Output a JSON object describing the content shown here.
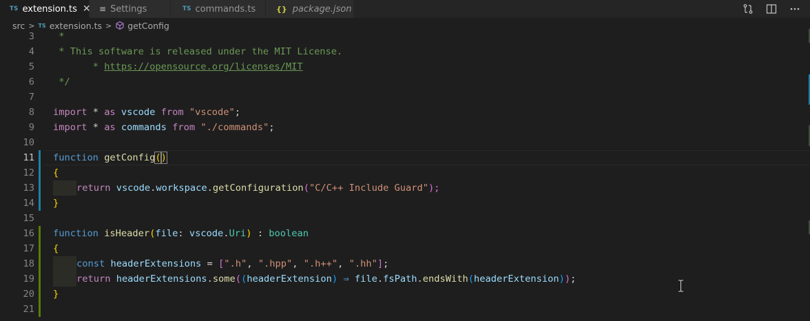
{
  "tabs": [
    {
      "badge": "TS",
      "label": "extension.ts",
      "active": true,
      "close": "✕"
    },
    {
      "badge": "≡",
      "label": "Settings"
    },
    {
      "badge": "TS",
      "label": "commands.ts"
    },
    {
      "badge": "{}",
      "label": "package.json"
    }
  ],
  "breadcrumb": {
    "folder": "src",
    "file_badge": "TS",
    "file": "extension.ts",
    "symbol": "getConfig",
    "separator": ">"
  },
  "editor": {
    "current_line": 11,
    "lines": [
      {
        "n": "3"
      },
      {
        "n": "4"
      },
      {
        "n": "5"
      },
      {
        "n": "6"
      },
      {
        "n": "7"
      },
      {
        "n": "8"
      },
      {
        "n": "9"
      },
      {
        "n": "10"
      },
      {
        "n": "11"
      },
      {
        "n": "12"
      },
      {
        "n": "13"
      },
      {
        "n": "14"
      },
      {
        "n": "15"
      },
      {
        "n": "16"
      },
      {
        "n": "17"
      },
      {
        "n": "18"
      },
      {
        "n": "19"
      },
      {
        "n": "20"
      },
      {
        "n": "21"
      }
    ],
    "code": {
      "l3": " *",
      "l4": " * This software is released under the MIT License.",
      "l5_prefix": " * ",
      "l5_link": "https://opensource.org/licenses/MIT",
      "l6": " */",
      "l8": [
        "import",
        " * ",
        "as",
        " ",
        "vscode",
        " ",
        "from",
        " ",
        "\"vscode\"",
        ";"
      ],
      "l9": [
        "import",
        " * ",
        "as",
        " ",
        "commands",
        " ",
        "from",
        " ",
        "\"./commands\"",
        ";"
      ],
      "l11": [
        "function",
        " ",
        "getConfig",
        "(",
        ")"
      ],
      "l12": "{",
      "l13": [
        "return",
        " ",
        "vscode",
        ".",
        "workspace",
        ".",
        "getConfiguration",
        "(",
        "\"C/C++ Include Guard\"",
        ");"
      ],
      "l14": "}",
      "l16": [
        "function",
        " ",
        "isHeader",
        "(",
        "file",
        ": ",
        "vscode",
        ".",
        "Uri",
        ")",
        " : ",
        "boolean"
      ],
      "l17": "{",
      "l18": [
        "const",
        " ",
        "headerExtensions",
        " = ",
        "[",
        "\".h\"",
        ", ",
        "\".hpp\"",
        ", ",
        "\".h++\"",
        ", ",
        "\".hh\"",
        "]",
        ";"
      ],
      "l19": [
        "return",
        " ",
        "headerExtensions",
        ".",
        "some",
        "(",
        "(",
        "headerExtension",
        ")",
        " ⇒ ",
        "file",
        ".",
        "fsPath",
        ".",
        "endsWith",
        "(",
        "headerExtension",
        ")",
        ")",
        ";"
      ],
      "l20": "}"
    }
  },
  "colors": {
    "background": "#1e1e1e",
    "comment": "#6a9955",
    "keyword_control": "#c586c0",
    "keyword": "#569cd6",
    "variable": "#9cdcfe",
    "string": "#ce9178",
    "function": "#dcdcaa",
    "type": "#4ec9b0",
    "modified_gutter": "#1b81a8",
    "added_gutter": "#587c0c"
  }
}
